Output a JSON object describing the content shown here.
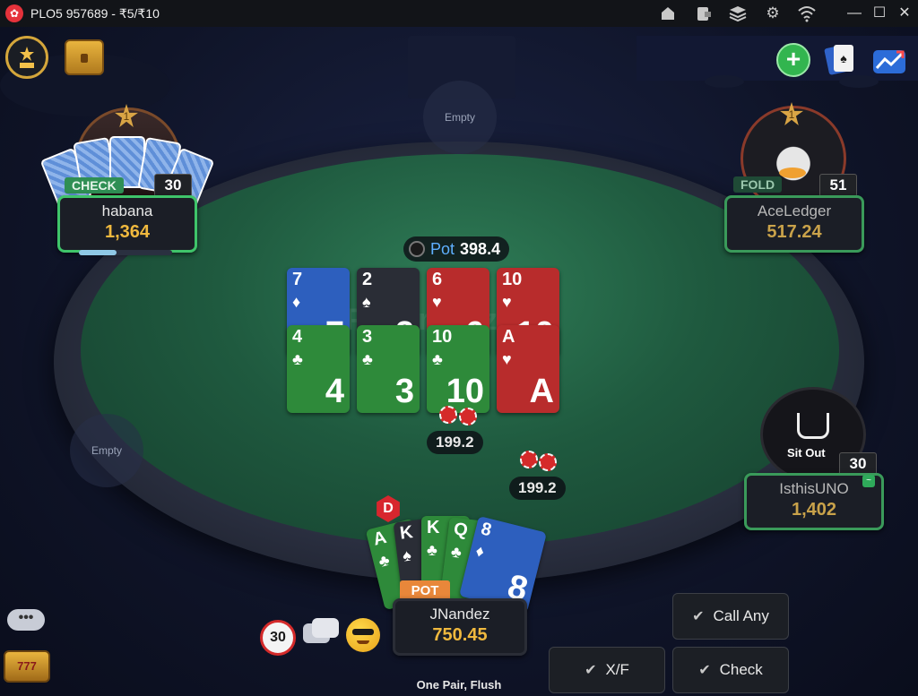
{
  "window": {
    "title": "PLO5 957689 - ₹5/₹10",
    "controls": {
      "minimize": "—",
      "maximize": "☐",
      "close": "✕"
    }
  },
  "icons": {
    "home": "home-icon",
    "wallet": "wallet-icon",
    "layers": "layers-icon",
    "settings": "gear-icon",
    "wifi": "wifi-icon",
    "leaderboard": "leaderboard-icon",
    "treasure": "treasure-chest-icon",
    "add_chips": "plus-icon",
    "cards": "cards-icon",
    "stats": "chart-icon"
  },
  "table": {
    "watermark": "Pokerbaazi",
    "empty_seats": [
      "Empty",
      "Empty"
    ],
    "pot_label": "Pot",
    "pot_value": "398.4",
    "side_bets": [
      "199.2",
      "199.2"
    ]
  },
  "board": {
    "top_row": [
      {
        "rank": "7",
        "suit": "♦",
        "color": "blue"
      },
      {
        "rank": "2",
        "suit": "♠",
        "color": "black"
      },
      {
        "rank": "6",
        "suit": "♥",
        "color": "red"
      },
      {
        "rank": "10",
        "suit": "♥",
        "color": "red"
      }
    ],
    "bottom_row": [
      {
        "rank": "4",
        "suit": "♣",
        "color": "green"
      },
      {
        "rank": "3",
        "suit": "♣",
        "color": "green"
      },
      {
        "rank": "10",
        "suit": "♣",
        "color": "green"
      },
      {
        "rank": "A",
        "suit": "♥",
        "color": "red"
      }
    ]
  },
  "players": {
    "habana": {
      "name": "habana",
      "stack": "1,364",
      "status": "CHECK",
      "timer": "30",
      "level": "1"
    },
    "aceledger": {
      "name": "AceLedger",
      "stack": "517.24",
      "status": "FOLD",
      "timer": "51",
      "level": "1"
    },
    "isthisuno": {
      "name": "IsthisUNO",
      "stack": "1,402",
      "status": "Sit Out",
      "timer": "30"
    },
    "hero": {
      "name": "JNandez",
      "stack": "750.45",
      "tag": "POT",
      "dealer": "D",
      "hand_description": "One Pair, Flush",
      "hole_cards": [
        {
          "rank": "A",
          "suit": "♣",
          "color": "green"
        },
        {
          "rank": "K",
          "suit": "♠",
          "color": "black"
        },
        {
          "rank": "K",
          "suit": "♣",
          "color": "green"
        },
        {
          "rank": "Q",
          "suit": "♣",
          "color": "green"
        },
        {
          "rank": "8",
          "suit": "♦",
          "color": "blue"
        }
      ]
    }
  },
  "bottom_bar": {
    "time_bank": "30",
    "chat_icon": "chat-icon",
    "emoji_icon": "emoji-icon",
    "more_icon": "more-icon",
    "slots_label": "777"
  },
  "actions": {
    "call_any": "Call Any",
    "xf": "X/F",
    "check": "Check"
  },
  "colors": {
    "felt": "#1f5a3f",
    "accent_green": "#3fc46a",
    "stack_gold": "#f0b93e",
    "card_blue": "#2d5fbe",
    "card_red": "#b82c2c",
    "card_green": "#2e8a3a",
    "card_black": "#2a2d36"
  }
}
